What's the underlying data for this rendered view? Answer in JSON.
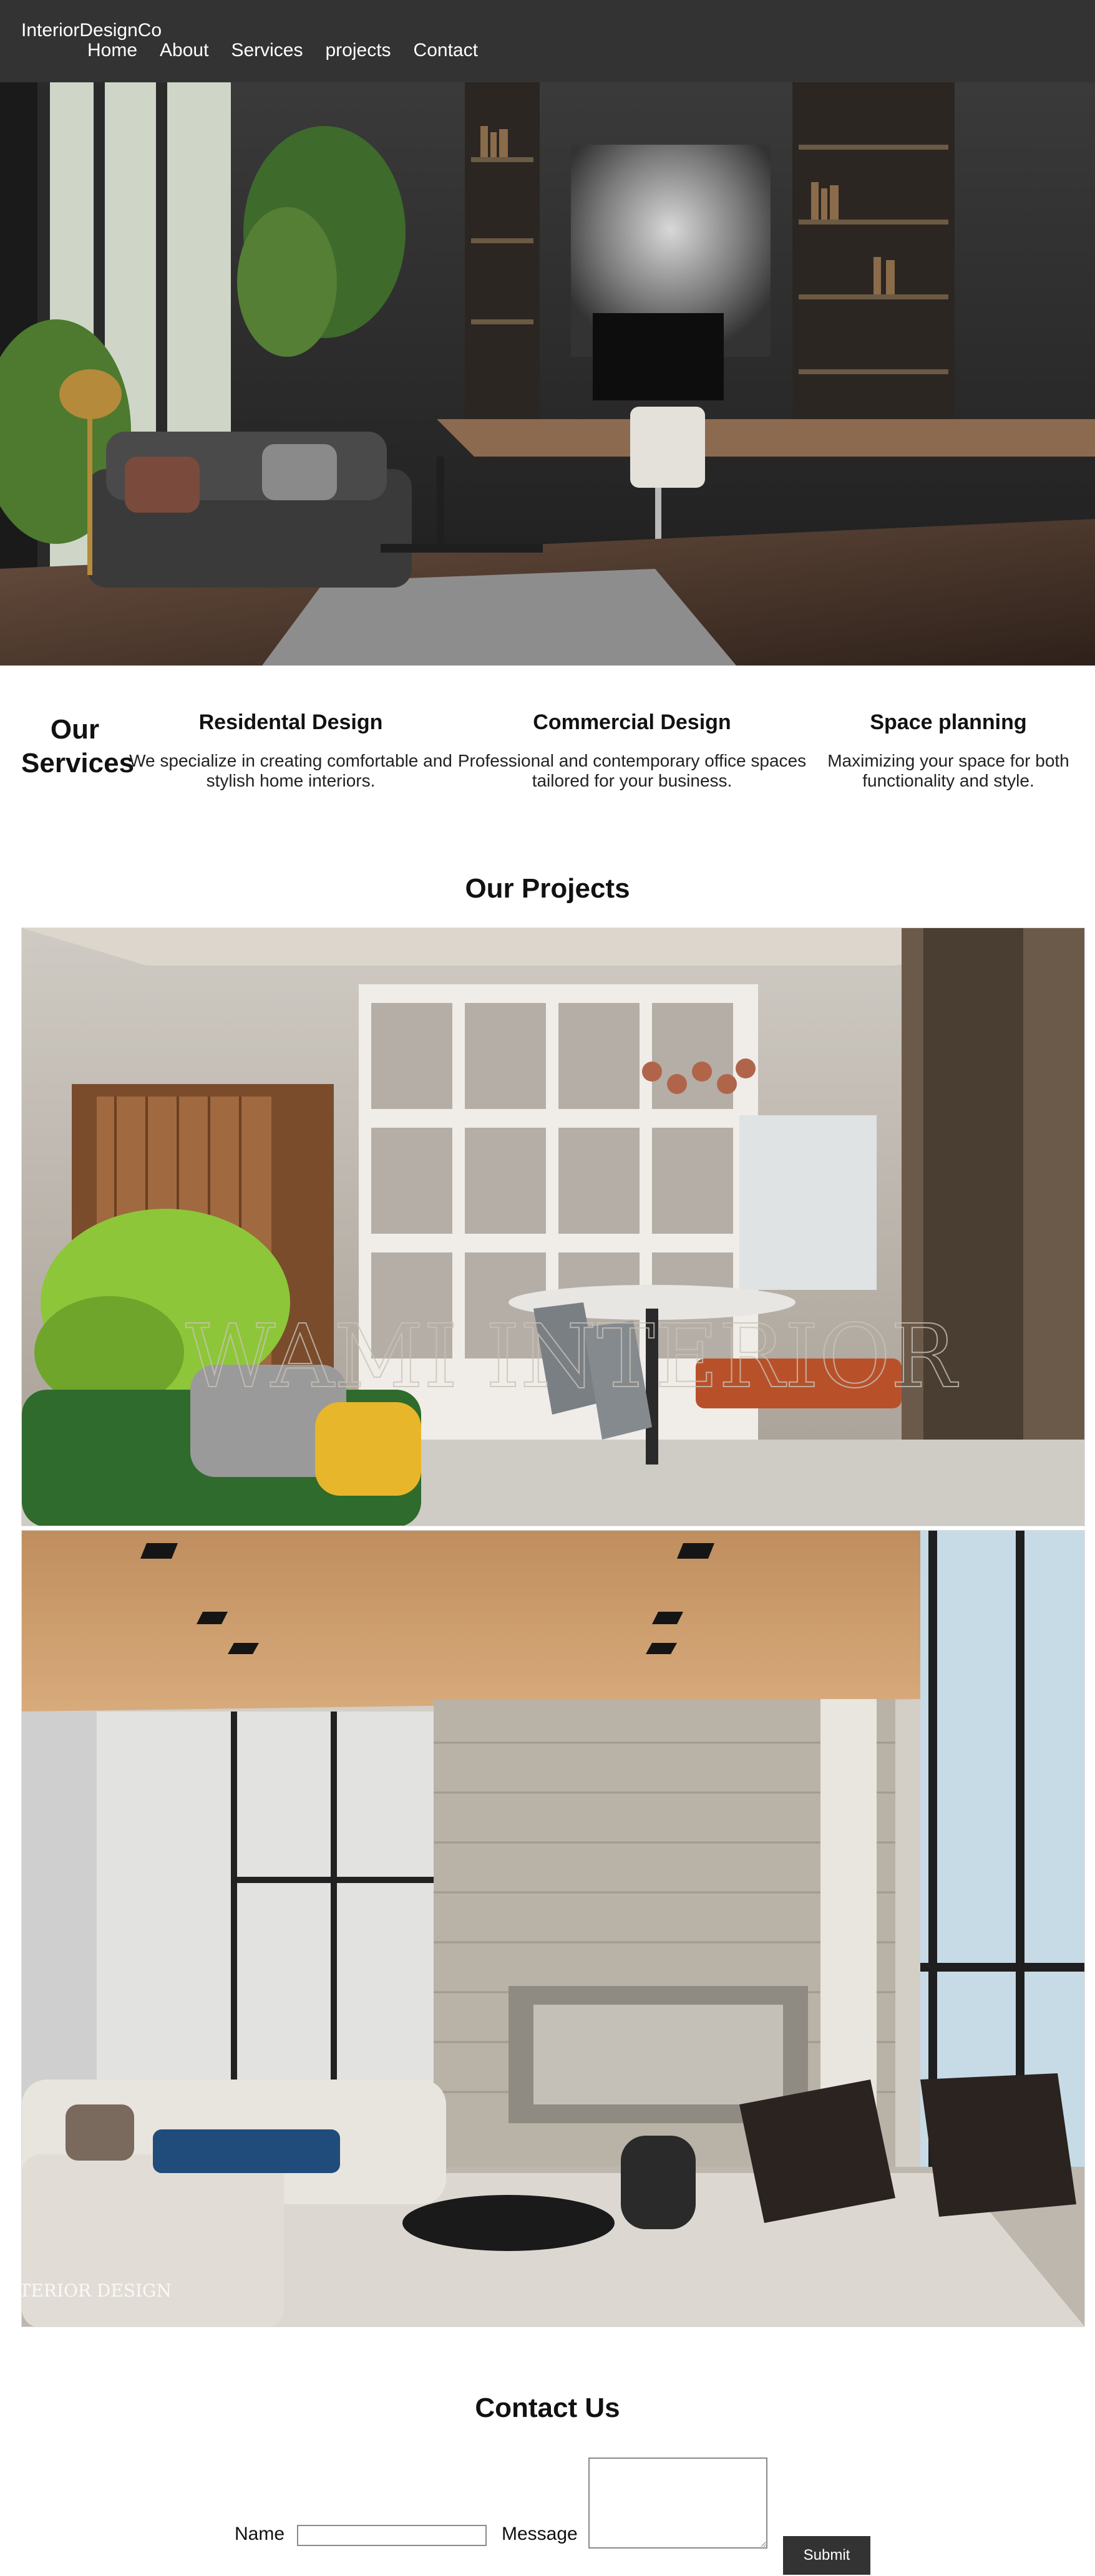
{
  "header": {
    "brand": "InteriorDesignCo",
    "nav": [
      "Home",
      "About",
      "Services",
      "projects",
      "Contact"
    ]
  },
  "services": {
    "title": "Our Services",
    "items": [
      {
        "title": "Residental Design",
        "text": "We specialize in creating comfortable and stylish home interiors."
      },
      {
        "title": "Commercial Design",
        "text": "Professional and contemporary office spaces tailored for your business."
      },
      {
        "title": "Space planning",
        "text": "Maximizing your space for both functionality and style."
      }
    ]
  },
  "projects": {
    "title": "Our Projects",
    "watermark_1": "WAMI INTERIOR",
    "watermark_2": "INTERIOR DESIGN"
  },
  "contact": {
    "title": "Contact Us",
    "name_label": "Name",
    "message_label": "Message",
    "submit_label": "Submit"
  },
  "colors": {
    "header_bg": "#333333",
    "button_bg": "#333333"
  }
}
